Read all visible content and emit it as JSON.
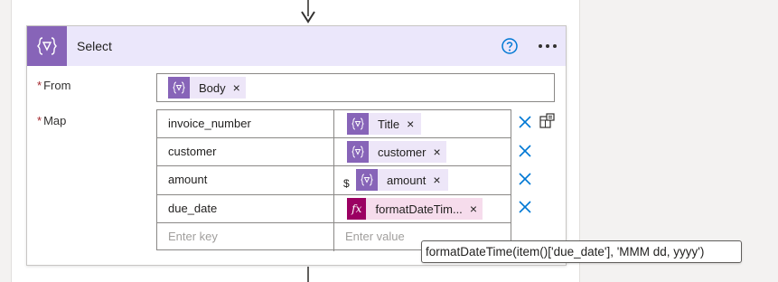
{
  "card": {
    "title": "Select",
    "accent_color": "#8764b8",
    "header_bg": "#ebe7fb",
    "icons": [
      "data-operation-icon",
      "help-icon",
      "more-options-icon"
    ]
  },
  "from": {
    "label": "From",
    "required_mark": "*",
    "token": {
      "label": "Body",
      "icon": "dynamic-content-icon"
    }
  },
  "map": {
    "label": "Map",
    "required_mark": "*",
    "rows": [
      {
        "key": "invoice_number",
        "value_token": "Title",
        "token_type": "dynamic"
      },
      {
        "key": "customer",
        "value_token": "customer",
        "token_type": "dynamic"
      },
      {
        "key": "amount",
        "prefix": "$",
        "value_token": "amount",
        "token_type": "dynamic"
      },
      {
        "key": "due_date",
        "value_token": "formatDateTim...",
        "token_type": "expression"
      }
    ],
    "new_row": {
      "key_placeholder": "Enter key",
      "value_placeholder": "Enter value"
    },
    "switch_mode_icon": "switch-to-text-mode-icon",
    "delete_icon": "delete-row-icon",
    "delete_color": "#0078d4"
  },
  "tooltip": {
    "text": "formatDateTime(item()['due_date'], 'MMM dd, yyyy')"
  },
  "token_close": "×"
}
